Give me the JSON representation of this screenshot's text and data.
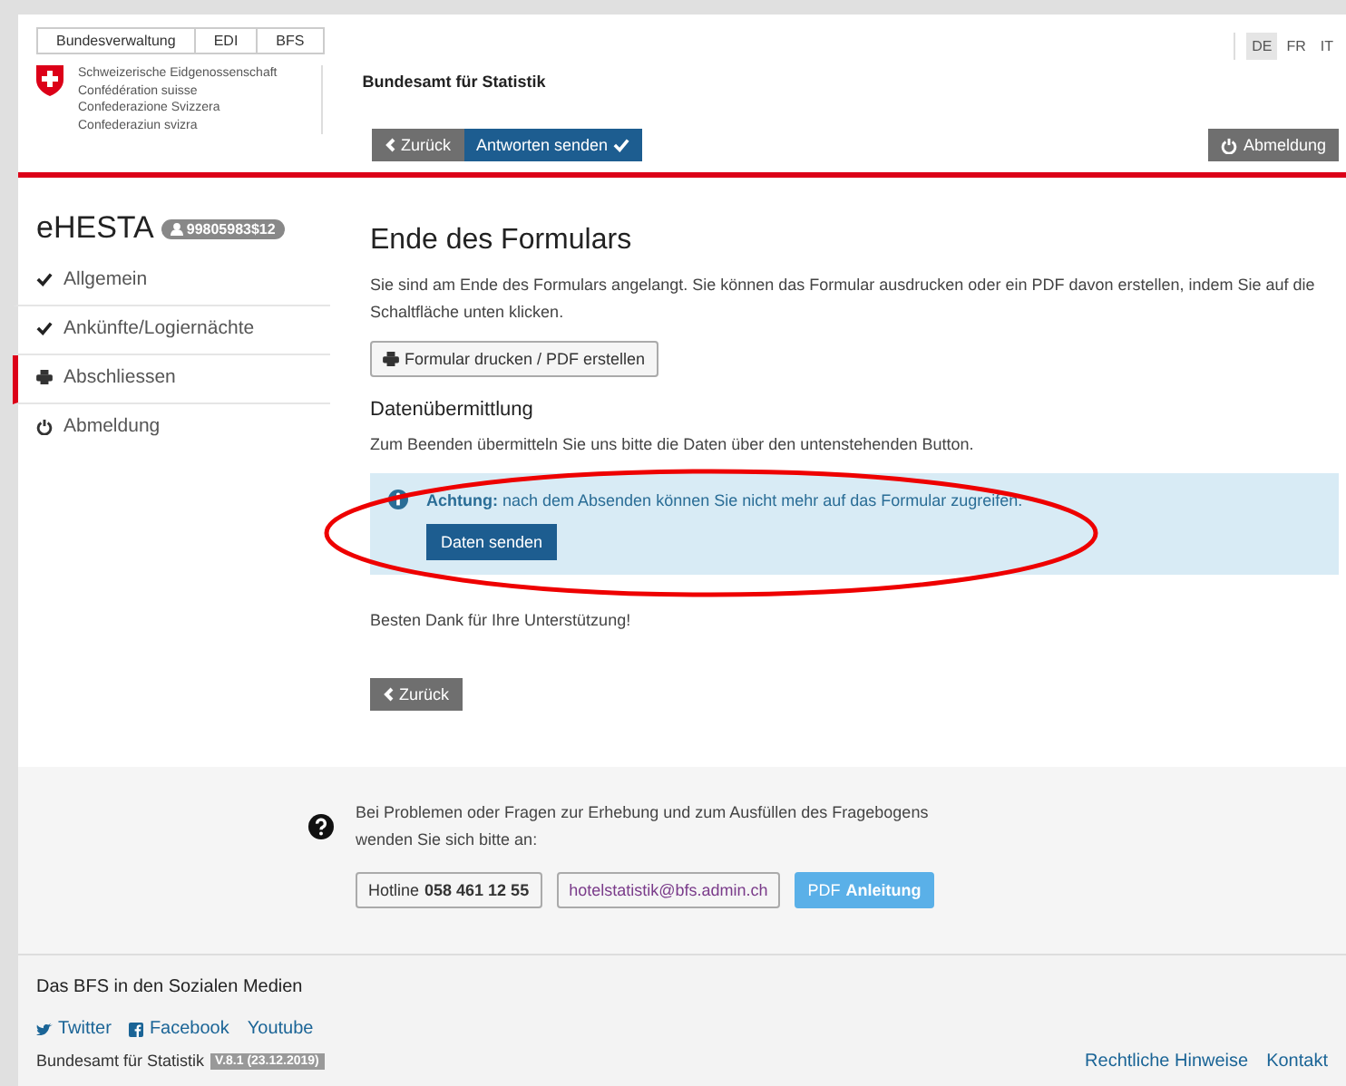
{
  "breadcrumb": [
    "Bundesverwaltung",
    "EDI",
    "BFS"
  ],
  "languages": [
    {
      "label": "DE",
      "selected": true
    },
    {
      "label": "FR",
      "selected": false
    },
    {
      "label": "IT",
      "selected": false
    }
  ],
  "federal_names": [
    "Schweizerische Eidgenossenschaft",
    "Confédération suisse",
    "Confederazione Svizzera",
    "Confederaziun svizra"
  ],
  "office_title": "Bundesamt für Statistik",
  "toolbar": {
    "back": "Zurück",
    "submit": "Antworten senden",
    "logout": "Abmeldung"
  },
  "app": {
    "title": "eHESTA",
    "user_badge": "99805983$12"
  },
  "sidebar": {
    "items": [
      {
        "label": "Allgemein",
        "kind": "completed",
        "selected": false
      },
      {
        "label": "Ankünfte/Logiernächte",
        "kind": "completed",
        "selected": false
      },
      {
        "label": "Abschliessen",
        "kind": "print",
        "selected": true
      },
      {
        "label": "Abmeldung",
        "kind": "logout",
        "selected": false
      }
    ]
  },
  "content": {
    "title": "Ende des Formulars",
    "intro": "Sie sind am Ende des Formulars angelangt. Sie können das Formular ausdrucken oder ein PDF davon erstellen, indem Sie auf die Schaltfläche unten klicken.",
    "print_button": "Formular drucken / PDF erstellen",
    "section_title": "Datenübermittlung",
    "section_text": "Zum Beenden übermitteln Sie uns bitte die Daten über den untenstehenden Button.",
    "alert": "**Achtung:** nach dem Absenden können Sie nicht mehr auf das Formular zugreifen.",
    "send_button": "Daten senden",
    "thanks": "Besten Dank für Ihre Unterstützung!",
    "back_button": "Zurück"
  },
  "help": {
    "text": "Bei Problemen oder Fragen zur Erhebung und zum Ausfüllen des Fragebogens wenden Sie sich bitte an:",
    "hotline": "Hotline **058 461 12 55**",
    "email": "hotelstatistik@bfs.admin.ch",
    "guide": "PDF **Anleitung**"
  },
  "social": {
    "title": "Das BFS in den Sozialen Medien",
    "links": [
      {
        "label": "Twitter",
        "kind": "twitter"
      },
      {
        "label": "Facebook",
        "kind": "facebook"
      },
      {
        "label": "Youtube",
        "kind": "plain"
      }
    ]
  },
  "footer": {
    "office": "Bundesamt für Statistik",
    "version": "V.8.1  (23.12.2019)",
    "links": [
      "Rechtliche Hinweise",
      "Kontakt"
    ]
  }
}
